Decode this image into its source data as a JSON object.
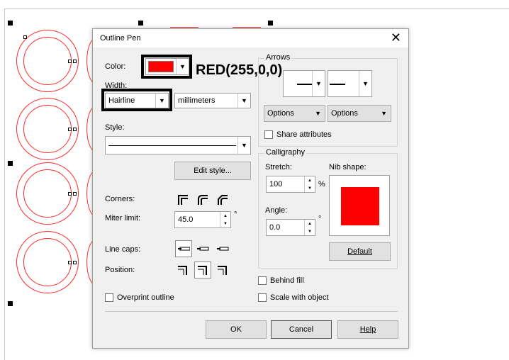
{
  "dialog": {
    "title": "Outline Pen",
    "close_glyph": "✕"
  },
  "annotation": {
    "text": "RED(255,0,0)"
  },
  "color": {
    "label": "Color:",
    "value": "#ff0000"
  },
  "width": {
    "label": "Width:",
    "value": "Hairline",
    "unit": "millimeters"
  },
  "style": {
    "label": "Style:",
    "edit_button": "Edit style..."
  },
  "corners": {
    "label": "Corners:"
  },
  "miter": {
    "label": "Miter limit:",
    "value": "45.0",
    "unit": "°"
  },
  "line_caps": {
    "label": "Line caps:"
  },
  "position": {
    "label": "Position:"
  },
  "overprint": {
    "label": "Overprint outline"
  },
  "arrows": {
    "title": "Arrows",
    "options_left": "Options",
    "options_right": "Options",
    "share": "Share attributes"
  },
  "calligraphy": {
    "title": "Calligraphy",
    "stretch_label": "Stretch:",
    "stretch_value": "100",
    "stretch_unit": "%",
    "angle_label": "Angle:",
    "angle_value": "0.0",
    "angle_unit": "°",
    "nib_label": "Nib shape:",
    "nib_color": "#ff0000",
    "default_button": "Default"
  },
  "behind_fill": {
    "label": "Behind fill"
  },
  "scale_with_object": {
    "label": "Scale with object"
  },
  "footer": {
    "ok": "OK",
    "cancel": "Cancel",
    "help": "Help"
  }
}
